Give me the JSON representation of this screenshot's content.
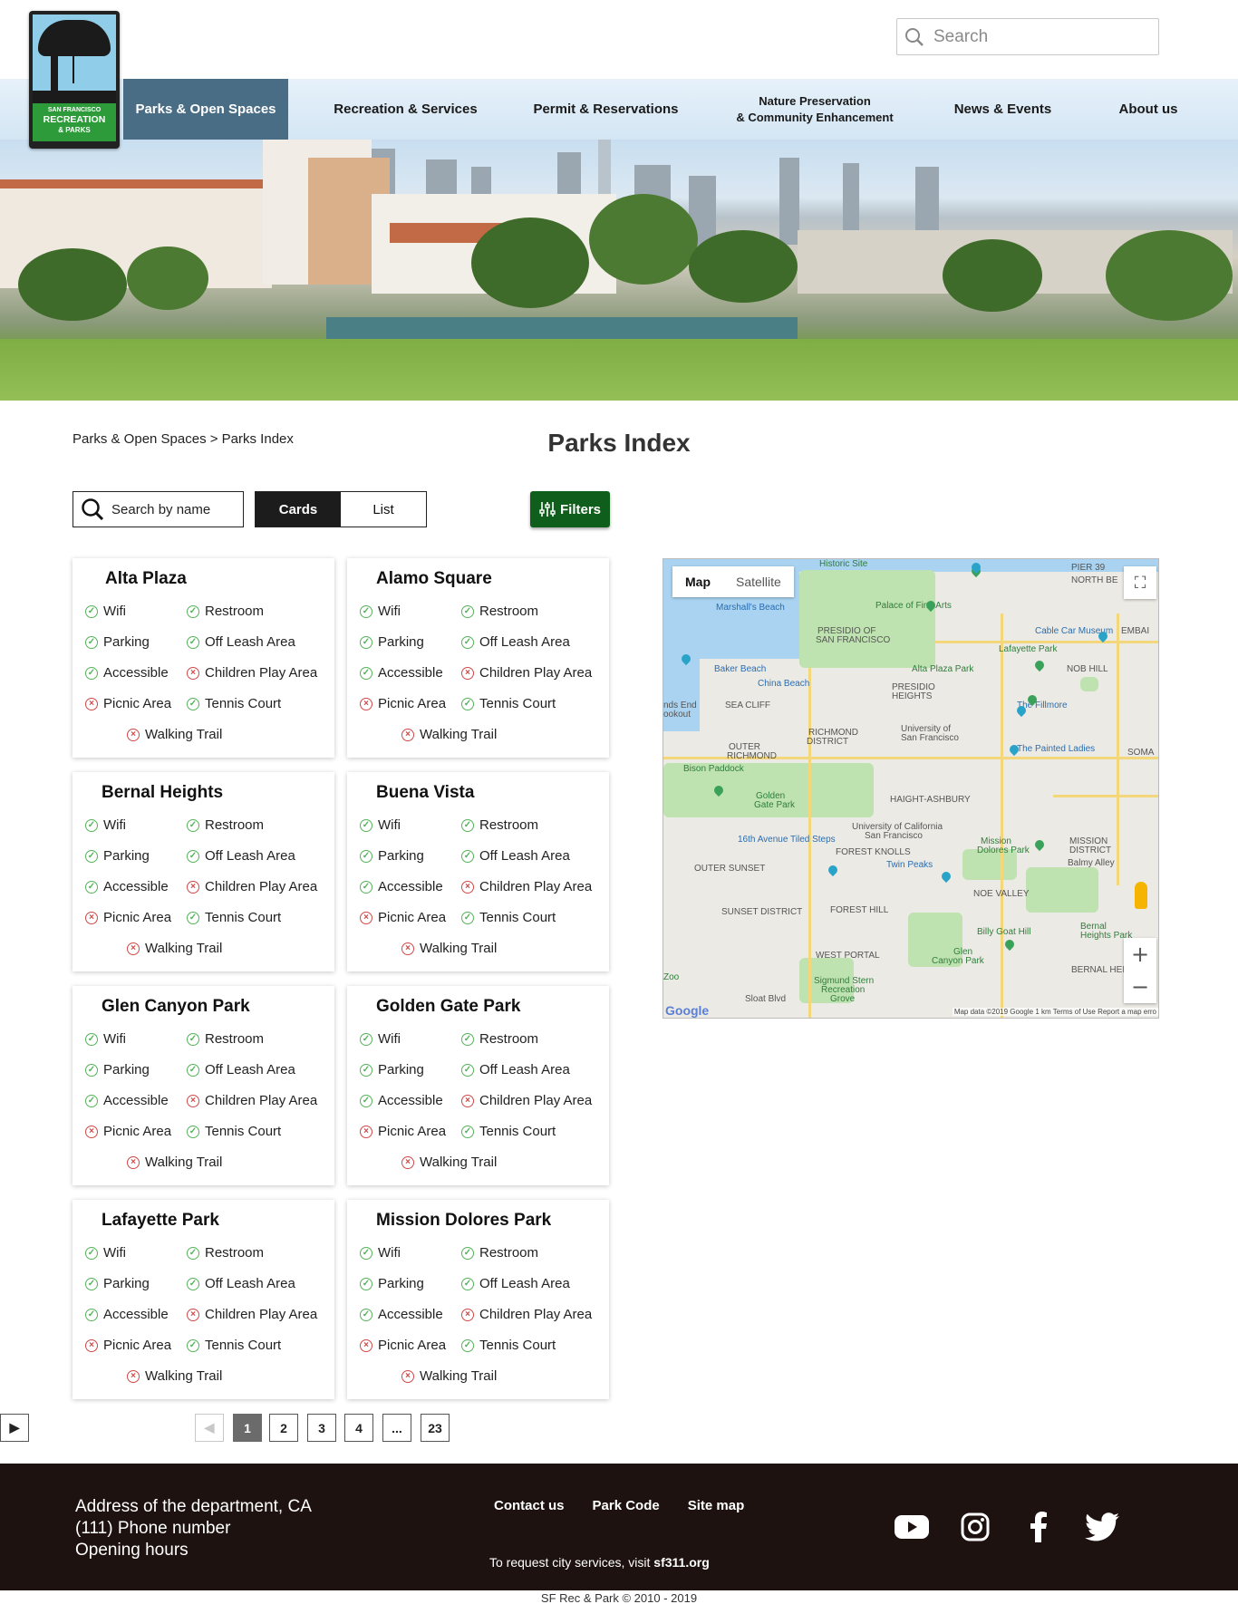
{
  "header": {
    "logo": {
      "line1": "SAN FRANCISCO",
      "line2": "RECREATION",
      "line3": "& PARKS"
    },
    "search_placeholder": "Search"
  },
  "nav": [
    {
      "label": "Parks & Open Spaces",
      "active": true
    },
    {
      "label": "Recreation & Services"
    },
    {
      "label": "Permit & Reservations"
    },
    {
      "label_line1": "Nature Preservation",
      "label_line2": "& Community Enhancement"
    },
    {
      "label": "News & Events"
    },
    {
      "label": "About us"
    }
  ],
  "breadcrumb": "Parks & Open Spaces > Parks Index",
  "page_title": "Parks Index",
  "controls": {
    "name_search_placeholder": "Search by name",
    "view_cards": "Cards",
    "view_list": "List",
    "filters": "Filters"
  },
  "amenity_labels": {
    "wifi": "Wifi",
    "restroom": "Restroom",
    "parking": "Parking",
    "off_leash": "Off Leash Area",
    "accessible": "Accessible",
    "children_play": "Children Play Area",
    "picnic": "Picnic Area",
    "tennis": "Tennis Court",
    "walking_trail": "Walking Trail"
  },
  "parks": [
    {
      "name": "Alta Plaza"
    },
    {
      "name": "Alamo Square"
    },
    {
      "name": "Bernal Heights"
    },
    {
      "name": "Buena Vista"
    },
    {
      "name": "Glen Canyon Park"
    },
    {
      "name": "Golden Gate Park"
    },
    {
      "name": "Lafayette Park"
    },
    {
      "name": "Mission Dolores Park"
    }
  ],
  "amenity_status": {
    "wifi": true,
    "restroom": true,
    "parking": true,
    "off_leash": true,
    "accessible": true,
    "children_play": false,
    "picnic": false,
    "tennis": true,
    "walking_trail": false
  },
  "map": {
    "type_map": "Map",
    "type_satellite": "Satellite",
    "labels": [
      "Historic Site",
      "PIER 39",
      "NORTH BE",
      "Marshall's Beach",
      "Palace of Fine Arts",
      "PRESIDIO OF",
      "SAN FRANCISCO",
      "Cable Car Museum",
      "EMBAI",
      "Lafayette Park",
      "Baker Beach",
      "Alta Plaza Park",
      "NOB HILL",
      "China Beach",
      "PRESIDIO",
      "HEIGHTS",
      "SEA CLIFF",
      "The Fillmore",
      "nds End",
      "ookout",
      "RICHMOND",
      "DISTRICT",
      "University of",
      "San Francisco",
      "OUTER",
      "RICHMOND",
      "The Painted Ladies",
      "SOMA",
      "Bison Paddock",
      "Golden",
      "Gate Park",
      "HAIGHT-ASHBURY",
      "University of California",
      "San Francisco",
      "16th Avenue Tiled Steps",
      "FOREST KNOLLS",
      "Mission",
      "Dolores Park",
      "MISSION",
      "DISTRICT",
      "Balmy Alley",
      "OUTER SUNSET",
      "Twin Peaks",
      "NOE VALLEY",
      "SUNSET DISTRICT",
      "FOREST HILL",
      "Billy Goat Hill",
      "Bernal",
      "Heights Park",
      "WEST PORTAL",
      "Glen",
      "Canyon Park",
      "BERNAL HEIGH",
      "Zoo",
      "Sigmund Stern",
      "Recreation",
      "Grove",
      "Sloat Blvd"
    ],
    "google": "Google",
    "attribution": "Map data ©2019 Google   1 km   Terms of Use   Report a map erro"
  },
  "pagination": {
    "prev": "◀",
    "pages": [
      "1",
      "2",
      "3",
      "4",
      "...",
      "23"
    ],
    "current": "1",
    "next": "▶"
  },
  "footer": {
    "address": "Address of the department, CA",
    "phone": "(111) Phone number",
    "hours": "Opening hours",
    "links": [
      "Contact us",
      "Park Code",
      "Site map"
    ],
    "request_text": "To request city services, visit",
    "request_link": "sf311.org",
    "social": [
      "youtube-icon",
      "instagram-icon",
      "facebook-icon",
      "twitter-icon"
    ]
  },
  "copyright": "SF Rec & Park © 2010 - 2019"
}
